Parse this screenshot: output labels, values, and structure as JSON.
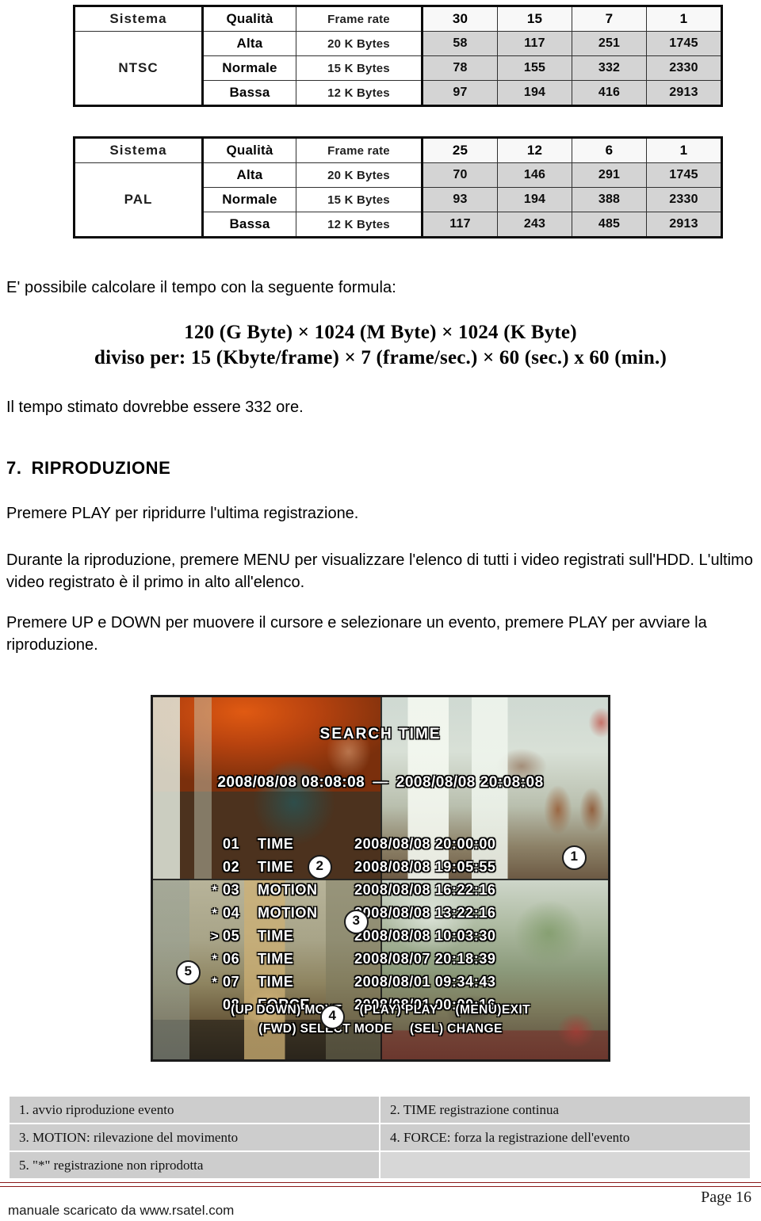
{
  "spec_tables": [
    {
      "id": "ntsc",
      "system": "NTSC",
      "headers": [
        "Sistema",
        "Qualità",
        "Frame rate",
        "30",
        "15",
        "7",
        "1"
      ],
      "rows": [
        {
          "quality": "Alta",
          "frame_rate": "20 K Bytes",
          "values": [
            "58",
            "117",
            "251",
            "1745"
          ]
        },
        {
          "quality": "Normale",
          "frame_rate": "15 K Bytes",
          "values": [
            "78",
            "155",
            "332",
            "2330"
          ]
        },
        {
          "quality": "Bassa",
          "frame_rate": "12 K Bytes",
          "values": [
            "97",
            "194",
            "416",
            "2913"
          ]
        }
      ]
    },
    {
      "id": "pal",
      "system": "PAL",
      "headers": [
        "Sistema",
        "Qualità",
        "Frame rate",
        "25",
        "12",
        "6",
        "1"
      ],
      "rows": [
        {
          "quality": "Alta",
          "frame_rate": "20 K Bytes",
          "values": [
            "70",
            "146",
            "291",
            "1745"
          ]
        },
        {
          "quality": "Normale",
          "frame_rate": "15 K Bytes",
          "values": [
            "93",
            "194",
            "388",
            "2330"
          ]
        },
        {
          "quality": "Bassa",
          "frame_rate": "12 K Bytes",
          "values": [
            "117",
            "243",
            "485",
            "2913"
          ]
        }
      ]
    }
  ],
  "body": {
    "intro": "E' possibile calcolare il tempo con la seguente formula:",
    "formula_line_1": "120 (G Byte) × 1024 (M Byte) × 1024 (K Byte)",
    "formula_line_2": "diviso per:  15 (Kbyte/frame) × 7 (frame/sec.) × 60 (sec.) x 60 (min.)",
    "estimate": "Il tempo stimato dovrebbe essere 332 ore.",
    "section_number": "7.",
    "section_title": "RIPRODUZIONE",
    "paragraph_1": "Premere PLAY per ripridurre l'ultima registrazione.",
    "paragraph_2": "Durante la riproduzione, premere MENU per visualizzare l'elenco di tutti i video registrati sull'HDD. L'ultimo video registrato è il primo in alto all'elenco.",
    "paragraph_3": "Premere UP e DOWN per muovere il cursore e selezionare un evento, premere PLAY per avviare la riproduzione."
  },
  "dvr": {
    "title": "SEARCH TIME",
    "range_start": "2008/08/08 08:08:08",
    "range_dash": "—",
    "range_end": "2008/08/08 20:08:08",
    "entries": [
      {
        "mark": "",
        "index": "01",
        "mode": "TIME",
        "timestamp": "2008/08/08  20:00:00"
      },
      {
        "mark": "",
        "index": "02",
        "mode": "TIME",
        "timestamp": "2008/08/08  19:05:55"
      },
      {
        "mark": "*",
        "index": "03",
        "mode": "MOTION",
        "timestamp": "2008/08/08  16:22:16"
      },
      {
        "mark": "*",
        "index": "04",
        "mode": "MOTION",
        "timestamp": "2008/08/08  13:22:16"
      },
      {
        "mark": ">",
        "index": "05",
        "mode": "TIME",
        "timestamp": "2008/08/08  10:03:30"
      },
      {
        "mark": "*",
        "index": "06",
        "mode": "TIME",
        "timestamp": "2008/08/07  20:18:39"
      },
      {
        "mark": "*",
        "index": "07",
        "mode": "TIME",
        "timestamp": "2008/08/01  09:34:43"
      },
      {
        "mark": "",
        "index": "08",
        "mode": "FORCE",
        "timestamp": "2008/08/01  00:00:16"
      }
    ],
    "help_line_1_a": "(UP DOWN) MOVE",
    "help_line_1_b": "(PLAY) PLAY",
    "help_line_1_c": "(MENU)EXIT",
    "help_line_2_a": "(FWD) SELECT MODE",
    "help_line_2_b": "(SEL) CHANGE",
    "callouts": [
      "1",
      "2",
      "3",
      "4",
      "5"
    ]
  },
  "legend": [
    {
      "left": "1. avvio riproduzione evento",
      "right": "2. TIME   registrazione continua"
    },
    {
      "left": "3. MOTION: rilevazione del movimento",
      "right": "4. FORCE:  forza la registrazione dell'evento"
    },
    {
      "left": "5. \"*\"  registrazione non riprodotta",
      "right": ""
    }
  ],
  "footer": {
    "page_number": "Page 16",
    "download_note": "manuale scaricato da www.rsatel.com",
    "rule_color": "#8b1a1a"
  }
}
